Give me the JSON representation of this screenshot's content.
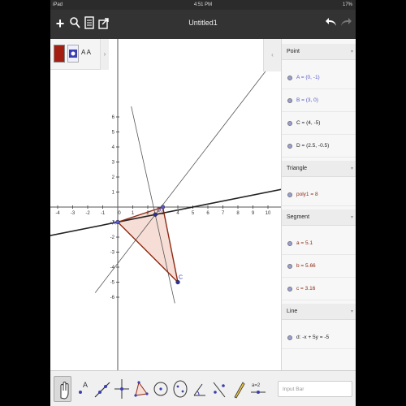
{
  "status_bar": {
    "carrier": "iPad",
    "time": "4:51 PM",
    "battery": "17%"
  },
  "toolbar": {
    "title": "Untitled1"
  },
  "style_bar": {
    "text_style": "A A"
  },
  "algebra": {
    "sections": [
      {
        "title": "Point",
        "items": [
          {
            "label": "A = (0, -1)",
            "color": "#5858c8"
          },
          {
            "label": "B = (3, 0)",
            "color": "#5858c8"
          },
          {
            "label": "C = (4, -5)",
            "color": "#222222"
          },
          {
            "label": "D = (2.5, -0.5)",
            "color": "#222222"
          }
        ]
      },
      {
        "title": "Triangle",
        "items": [
          {
            "label": "poly1 = 8",
            "color": "#8b2a12"
          }
        ]
      },
      {
        "title": "Segment",
        "items": [
          {
            "label": "a = 5.1",
            "color": "#8b2a12"
          },
          {
            "label": "b = 5.66",
            "color": "#8b2a12"
          },
          {
            "label": "c = 3.16",
            "color": "#8b2a12"
          }
        ]
      },
      {
        "title": "Line",
        "items": [
          {
            "label": "d: -x + 5y = -5",
            "color": "#222222"
          }
        ]
      }
    ]
  },
  "graph": {
    "x_ticks": [
      "-4",
      "-3",
      "-2",
      "-1",
      "0",
      "1",
      "2",
      "3",
      "4",
      "5",
      "6",
      "7",
      "8",
      "9",
      "10"
    ],
    "y_ticks": [
      "6",
      "5",
      "4",
      "3",
      "2",
      "1",
      "-1",
      "-2",
      "-3",
      "-4",
      "-5",
      "-6"
    ],
    "point_labels": [
      "A",
      "D",
      "C"
    ],
    "triangle_fill": "#f6ddd5",
    "segment_color": "#8b2a12"
  },
  "input_bar": {
    "placeholder": "Input Bar"
  },
  "tool_labels": {
    "text": "A",
    "slider": "a=2"
  }
}
